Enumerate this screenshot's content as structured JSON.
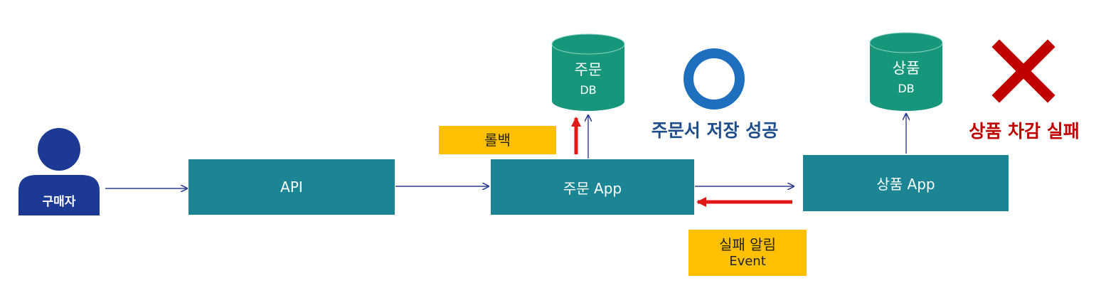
{
  "actors": {
    "buyer": "구매자"
  },
  "boxes": {
    "api": "API",
    "order_app": "주문 App",
    "product_app": "상품 App"
  },
  "databases": {
    "order": {
      "name": "주문",
      "type": "DB"
    },
    "product": {
      "name": "상품",
      "type": "DB"
    }
  },
  "notes": {
    "rollback": "롤백",
    "fail_notify": "실패 알림",
    "fail_notify_sub": "Event"
  },
  "status": {
    "success": "주문서 저장 성공",
    "failure": "상품 차감 실패"
  },
  "colors": {
    "box": "#1b8593",
    "db": "#16977b",
    "person": "#1c3a94",
    "note": "#ffc000",
    "arrow": "#2e3f8f",
    "red_arrow": "#e01818",
    "success_text": "#1f4e8c",
    "failure_text": "#c00000",
    "ring": "#1f6fbf",
    "cross": "#c00000"
  },
  "icons": {
    "success_mark": "circle-o-icon",
    "failure_mark": "x-icon"
  }
}
